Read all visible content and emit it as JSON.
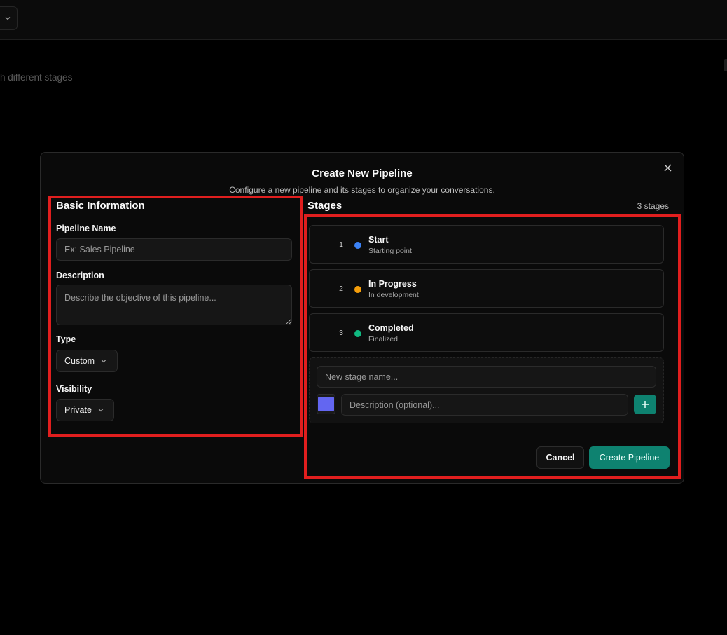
{
  "background": {
    "subtitle": "h different stages"
  },
  "modal": {
    "title": "Create New Pipeline",
    "description": "Configure a new pipeline and its stages to organize your conversations.",
    "close_icon": "close-icon"
  },
  "basic_info": {
    "heading": "Basic Information",
    "pipeline_name": {
      "label": "Pipeline Name",
      "placeholder": "Ex: Sales Pipeline",
      "value": ""
    },
    "description": {
      "label": "Description",
      "placeholder": "Describe the objective of this pipeline...",
      "value": ""
    },
    "type": {
      "label": "Type",
      "value": "Custom"
    },
    "visibility": {
      "label": "Visibility",
      "value": "Private"
    }
  },
  "stages": {
    "heading": "Stages",
    "count_label": "3 stages",
    "items": [
      {
        "number": "1",
        "name": "Start",
        "description": "Starting point",
        "color": "#3b82f6"
      },
      {
        "number": "2",
        "name": "In Progress",
        "description": "In development",
        "color": "#f59e0b"
      },
      {
        "number": "3",
        "name": "Completed",
        "description": "Finalized",
        "color": "#10b981"
      }
    ],
    "new_stage": {
      "name_placeholder": "New stage name...",
      "description_placeholder": "Description (optional)...",
      "color": "#6366f1",
      "add_icon": "plus-icon"
    }
  },
  "actions": {
    "cancel_label": "Cancel",
    "create_label": "Create Pipeline"
  },
  "colors": {
    "accent": "#0e8270",
    "highlight": "#e01e1e"
  }
}
